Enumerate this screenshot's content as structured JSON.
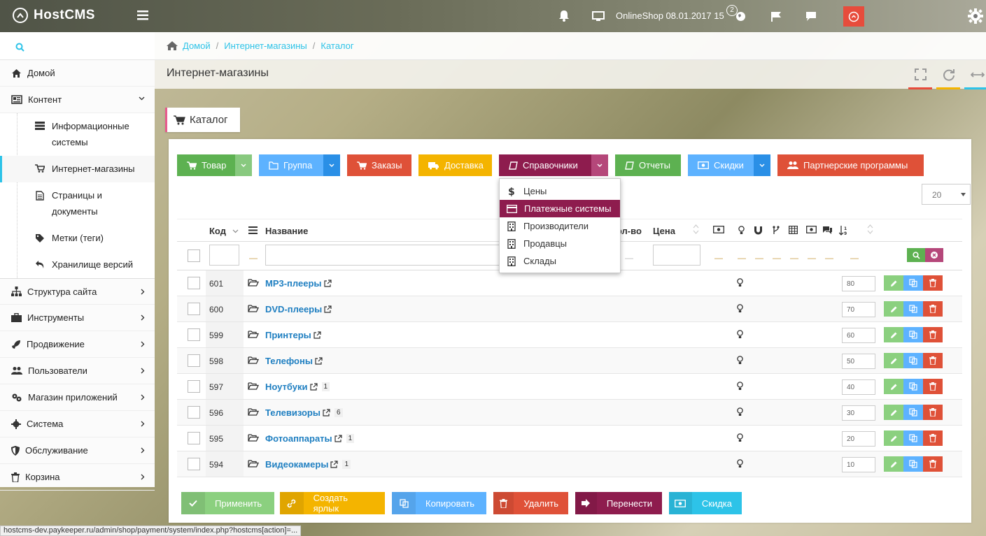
{
  "app": {
    "logo": "HostCMS"
  },
  "topbar": {
    "site": "OnlineShop 08.01.2017 15",
    "notif_count": "2"
  },
  "sidebar": {
    "search_icon": "search-icon",
    "items": [
      {
        "label": "Домой",
        "icon": "home-icon"
      },
      {
        "label": "Контент",
        "icon": "newspaper-icon"
      },
      {
        "label": "Структура сайта",
        "icon": "sitemap-icon"
      },
      {
        "label": "Инструменты",
        "icon": "briefcase-icon"
      },
      {
        "label": "Продвижение",
        "icon": "rocket-icon"
      },
      {
        "label": "Пользователи",
        "icon": "users-icon"
      },
      {
        "label": "Магазин приложений",
        "icon": "puzzle-icon"
      },
      {
        "label": "Система",
        "icon": "gear-icon"
      },
      {
        "label": "Обслуживание",
        "icon": "shield-icon"
      },
      {
        "label": "Корзина",
        "icon": "trash-icon"
      }
    ],
    "sub": [
      {
        "label": "Информационные системы"
      },
      {
        "label": "Интернет-магазины"
      },
      {
        "label": "Страницы и документы"
      },
      {
        "label": "Метки (теги)"
      },
      {
        "label": "Хранилище версий"
      }
    ]
  },
  "breadcrumb": [
    "Домой",
    "Интернет-магазины",
    "Каталог"
  ],
  "page": {
    "title": "Интернет-магазины",
    "tab": "Каталог"
  },
  "toolbar": {
    "product": "Товар",
    "group": "Группа",
    "orders": "Заказы",
    "delivery": "Доставка",
    "refs": "Справочники",
    "reports": "Отчеты",
    "discounts": "Скидки",
    "partners": "Партнерские программы"
  },
  "dropdown": [
    "Цены",
    "Платежные системы",
    "Производители",
    "Продавцы",
    "Склады"
  ],
  "page_size": "20",
  "table": {
    "headers": {
      "code": "Код",
      "name": "Название",
      "qty": "Кол-во",
      "price": "Цена"
    },
    "rows": [
      {
        "code": "601",
        "name": "МР3-плееры",
        "count": "",
        "sort": "80"
      },
      {
        "code": "600",
        "name": "DVD-плееры",
        "count": "",
        "sort": "70"
      },
      {
        "code": "599",
        "name": "Принтеры",
        "count": "",
        "sort": "60"
      },
      {
        "code": "598",
        "name": "Телефоны",
        "count": "",
        "sort": "50"
      },
      {
        "code": "597",
        "name": "Ноутбуки",
        "count": "1",
        "sort": "40"
      },
      {
        "code": "596",
        "name": "Телевизоры",
        "count": "6",
        "sort": "30"
      },
      {
        "code": "595",
        "name": "Фотоаппараты",
        "count": "1",
        "sort": "20"
      },
      {
        "code": "594",
        "name": "Видеокамеры",
        "count": "1",
        "sort": "10"
      }
    ]
  },
  "bottom": {
    "apply": "Применить",
    "shortcut": "Создать ярлык",
    "copy": "Копировать",
    "delete": "Удалить",
    "move": "Перенести",
    "discount": "Скидка"
  },
  "statusbar": "hostcms-dev.paykeeper.ru/admin/shop/payment/system/index.php?hostcms[action]=...",
  "colors": {
    "green": "#5db151",
    "blue": "#5db2ff",
    "red": "#df5138",
    "orange": "#f4b400",
    "maroon": "#8e1c4e",
    "cyan": "#2dc3e8"
  }
}
